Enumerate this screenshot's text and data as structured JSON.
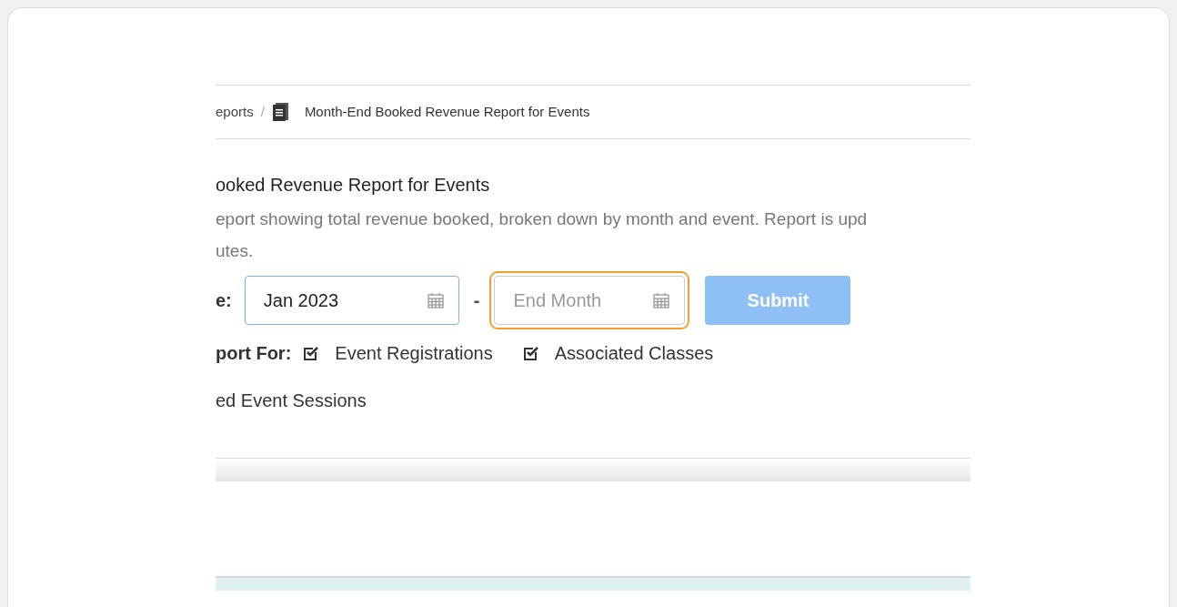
{
  "breadcrumb": {
    "parent": "eports",
    "separator": "/",
    "current": "Month-End Booked Revenue Report for Events"
  },
  "title": "ooked Revenue Report for Events",
  "description_lines": [
    "eport showing total revenue booked, broken down by month and event. Report is upd",
    "utes."
  ],
  "date_range": {
    "label": "e:",
    "start": {
      "value": "Jan 2023",
      "focused": false
    },
    "separator": "-",
    "end": {
      "placeholder": "End Month",
      "focused": true
    },
    "submit": {
      "label": "Submit",
      "disabled": true
    }
  },
  "report_for": {
    "label": "port For:",
    "options": [
      {
        "label": "Event Registrations",
        "checked": true
      },
      {
        "label": "Associated Classes",
        "checked": true
      }
    ],
    "next_line": "ed Event Sessions"
  }
}
